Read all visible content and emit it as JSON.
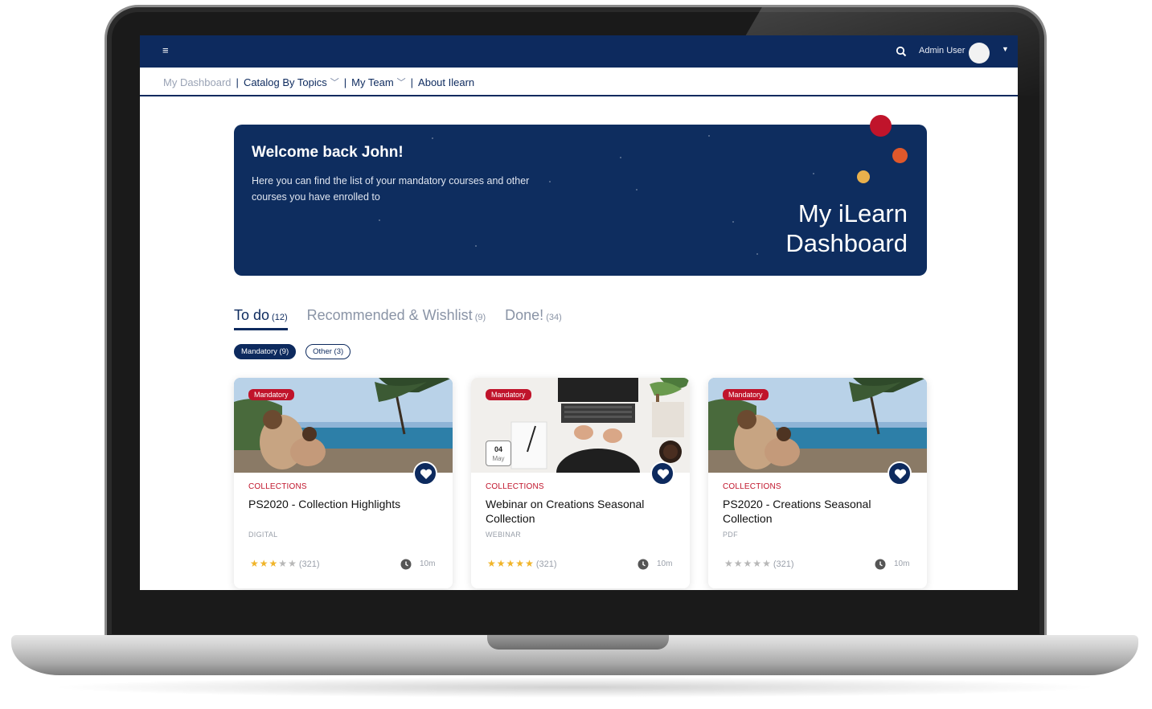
{
  "topbar": {
    "menu_icon": "hamburger-icon",
    "search_icon": "search-icon",
    "user_name": "Admin User",
    "caret_icon": "caret-down-icon"
  },
  "nav": {
    "items": [
      {
        "label": "My Dashboard",
        "has_dropdown": false
      },
      {
        "label": "Catalog By Topics",
        "has_dropdown": true
      },
      {
        "label": "My Team",
        "has_dropdown": true
      },
      {
        "label": "About Ilearn",
        "has_dropdown": false
      }
    ]
  },
  "hero": {
    "title": "Welcome back John!",
    "subtitle": "Here you can find the list of your mandatory courses and other courses you have enrolled to",
    "brand_line1": "My iLearn",
    "brand_line2": "Dashboard",
    "colors": {
      "background": "#0e2d5f",
      "dot_red": "#c0142b",
      "dot_orange": "#e0582a",
      "dot_yellow": "#e9b04c"
    }
  },
  "tabs": [
    {
      "label": "To do",
      "count": "(12)",
      "active": true
    },
    {
      "label": "Recommended & Wishlist",
      "count": "(9)",
      "active": false
    },
    {
      "label": "Done!",
      "count": "(34)",
      "active": false
    }
  ],
  "filters": [
    {
      "label": "Mandatory (9)",
      "active": true
    },
    {
      "label": "Other (3)",
      "active": false
    }
  ],
  "cards": [
    {
      "badge": "Mandatory",
      "category": "COLLECTIONS",
      "title": "PS2020 - Collection Highlights",
      "type": "DIGITAL",
      "rating_stars": 3,
      "rating_count": "(321)",
      "duration": "10m",
      "image": "resort-pool-photo",
      "date_day": "",
      "date_month": ""
    },
    {
      "badge": "Mandatory",
      "category": "COLLECTIONS",
      "title": "Webinar on Creations Seasonal Collection",
      "type": "WEBINAR",
      "rating_stars": 5,
      "rating_count": "(321)",
      "duration": "10m",
      "image": "laptop-desk-photo",
      "date_day": "04",
      "date_month": "May"
    },
    {
      "badge": "Mandatory",
      "category": "COLLECTIONS",
      "title": "PS2020 - Creations Seasonal Collection",
      "type": "PDF",
      "rating_stars": 0,
      "rating_count": "(321)",
      "duration": "10m",
      "image": "resort-pool-photo",
      "date_day": "",
      "date_month": ""
    }
  ],
  "colors": {
    "navy": "#0d2a5e",
    "red": "#c0142b",
    "star_gold": "#f0b429"
  }
}
